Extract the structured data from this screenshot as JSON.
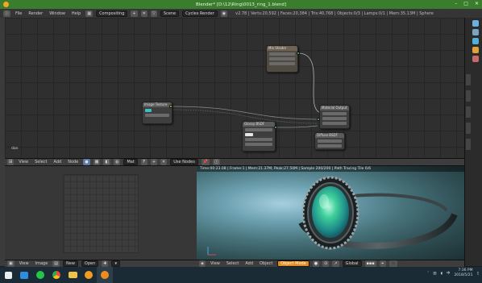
{
  "window": {
    "title": "Blender* [D:\\12\\Ring\\0013_ring_1.blend]",
    "minimize": "–",
    "maximize": "□",
    "close": "✕"
  },
  "infobar": {
    "menus": [
      "File",
      "Render",
      "Window",
      "Help"
    ],
    "layout": "Compositing",
    "scene": "Scene",
    "engine": "Cycles Render",
    "stats": "v2.78 | Verts:20,592 | Faces:20,384 | Tris:40,768 | Objects:0/3 | Lamps:0/1 | Mem:35.13M | Sphere"
  },
  "node_editor": {
    "dimensions_label": "dan",
    "nodes": [
      {
        "id": "image",
        "title": "Image Texture"
      },
      {
        "id": "mix",
        "title": "Mix Shader"
      },
      {
        "id": "output",
        "title": "Material Output"
      },
      {
        "id": "glossy",
        "title": "Glossy BSDF"
      },
      {
        "id": "diffuse",
        "title": "Diffuse BSDF"
      }
    ]
  },
  "node_header": {
    "menus": [
      "View",
      "Select",
      "Add",
      "Node"
    ],
    "material": "Mat",
    "use_nodes": "Use Nodes"
  },
  "render": {
    "stats": "Time:00:23.08 | Frame:1 | Mem:21.37M, Peak:27.50M | Sample 200/200 | Path Tracing Tile 6/6"
  },
  "uv_header": {
    "menus": [
      "View",
      "Image"
    ],
    "image": "New",
    "open": "Open"
  },
  "view3d_header": {
    "menus": [
      "View",
      "Select",
      "Add",
      "Object"
    ],
    "mode": "Object Mode",
    "orientation": "Global"
  },
  "taskbar": {
    "icons": [
      "windows-logo",
      "file-explorer",
      "chat-app",
      "chrome",
      "folder",
      "media-player",
      "blender"
    ],
    "time": "7:36 PM",
    "date": "2018/5/21"
  },
  "colors": {
    "title_bar": "#3a7d2c",
    "accent": "#e08a22",
    "gem": "#3fcf9b"
  }
}
